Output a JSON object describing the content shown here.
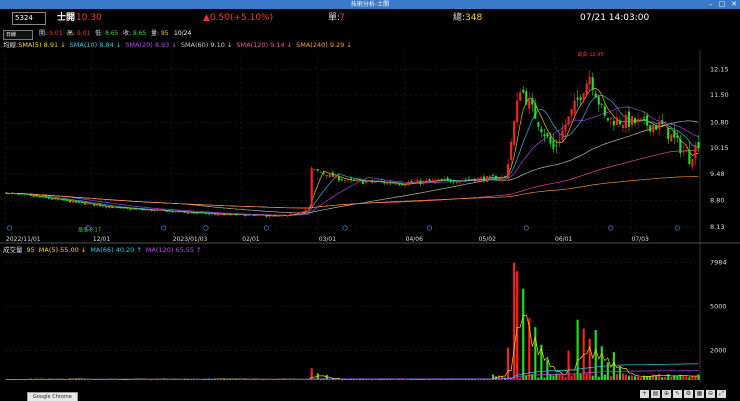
{
  "window": {
    "title": "技術分析-士開",
    "min": "–",
    "max": "□",
    "close": "✕"
  },
  "header": {
    "stock_code": "5324",
    "stock_name": "士開",
    "price": "10.30",
    "change": "▲0.50(+5.10%)",
    "single_label": "單:",
    "single_value": "7",
    "total_label": "總:",
    "total_value": "348",
    "datetime": "07/21 14:03:00"
  },
  "ohlc": {
    "period": "日線",
    "open_label": "開:",
    "open": "9.01",
    "high_label": "高:",
    "high": "9.01",
    "low_label": "低:",
    "low": "8.65",
    "close_label": "收:",
    "close": "8.65",
    "volume_label": "量:",
    "volume": "95",
    "date": "10/24"
  },
  "ma_legend": {
    "prefix": "均線:",
    "items": [
      {
        "text": "SMA(5) 8.91 ↓",
        "color": "#ffd700"
      },
      {
        "text": "SMA(10) 8.84 ↓",
        "color": "#22d3e8"
      },
      {
        "text": "SMA(20) 8.93 ↓",
        "color": "#c040ff"
      },
      {
        "text": "SMA(60) 9.10 ↓",
        "color": "#c8c8c8"
      },
      {
        "text": "SMA(120) 9.14 ↓",
        "color": "#ff4fa0"
      },
      {
        "text": "SMA(240) 9.29 ↓",
        "color": "#ff9a30"
      }
    ]
  },
  "vol_legend": {
    "prefix": "成交量",
    "value": "95",
    "items": [
      {
        "text": "MA(5) 55.00 ↓",
        "color": "#ffd700"
      },
      {
        "text": "MA(66) 40.20 ↑",
        "color": "#22d3e8"
      },
      {
        "text": "MA(120) 65.55 ↑",
        "color": "#c040ff"
      }
    ]
  },
  "annotations": {
    "high_mark": "最高:12.45",
    "low_mark": "最低:8.17"
  },
  "price_axis": [
    "12.15",
    "11.50",
    "10.80",
    "10.15",
    "9.48",
    "8.80",
    "8.13"
  ],
  "volume_axis": [
    "7984",
    "5000",
    "2000"
  ],
  "date_axis": [
    "2022/11/01",
    "12/01",
    "2023/01/03",
    "02/01",
    "03/01",
    "04/06",
    "05/02",
    "06/01",
    "07/03"
  ],
  "taskbar_hint": "Google Chrome",
  "toolbar_icons": [
    "cross-icon",
    "print-icon",
    "zoom-in-icon",
    "cursor-icon",
    "settings-icon",
    "grid-icon",
    "zoom-out-icon",
    "expand-icon"
  ],
  "colors": {
    "up": "#ff2020",
    "down": "#22e022",
    "price_up": "#ff3030",
    "accent_blue": "#3a78c8"
  },
  "chart_data": [
    {
      "type": "candlestick",
      "title": "",
      "x_ticks": [
        "2022/11/01",
        "12/01",
        "2023/01/03",
        "02/01",
        "03/01",
        "04/06",
        "05/02",
        "06/01",
        "07/03"
      ],
      "ylim": [
        8.0,
        12.6
      ],
      "y_ticks": [
        12.15,
        11.5,
        10.8,
        10.15,
        9.48,
        8.8,
        8.13
      ],
      "high": 12.45,
      "low": 8.17,
      "segments": [
        {
          "from": 0,
          "to": 38,
          "start": 9.0,
          "end": 8.6
        },
        {
          "from": 38,
          "to": 70,
          "start": 8.6,
          "end": 8.45
        },
        {
          "from": 70,
          "to": 92,
          "start": 8.45,
          "end": 8.4
        },
        {
          "from": 92,
          "to": 100,
          "start": 8.4,
          "end": 8.6
        },
        {
          "from": 100,
          "to": 101,
          "start": 8.6,
          "end": 9.6
        },
        {
          "from": 101,
          "to": 113,
          "start": 9.6,
          "end": 9.3
        },
        {
          "from": 113,
          "to": 131,
          "start": 9.3,
          "end": 9.25
        },
        {
          "from": 131,
          "to": 165,
          "start": 9.25,
          "end": 9.4
        },
        {
          "from": 165,
          "to": 170,
          "start": 9.4,
          "end": 11.7
        },
        {
          "from": 170,
          "to": 181,
          "start": 11.7,
          "end": 10.1
        },
        {
          "from": 181,
          "to": 193,
          "start": 10.1,
          "end": 12.0
        },
        {
          "from": 193,
          "to": 198,
          "start": 12.0,
          "end": 10.9
        },
        {
          "from": 198,
          "to": 217,
          "start": 10.9,
          "end": 10.7
        },
        {
          "from": 217,
          "to": 226,
          "start": 10.7,
          "end": 9.9
        },
        {
          "from": 226,
          "to": 229,
          "start": 9.9,
          "end": 10.3
        }
      ],
      "count": 230
    },
    {
      "type": "bar",
      "title": "成交量",
      "ylim": [
        0,
        8300
      ],
      "y_ticks": [
        7984,
        5000,
        2000
      ],
      "spikes": [
        {
          "index": 101,
          "value": 800
        },
        {
          "index": 103,
          "value": 450
        },
        {
          "index": 106,
          "value": 350
        },
        {
          "index": 166,
          "value": 2200
        },
        {
          "index": 168,
          "value": 7984
        },
        {
          "index": 169,
          "value": 7400
        },
        {
          "index": 171,
          "value": 6200
        },
        {
          "index": 173,
          "value": 4200
        },
        {
          "index": 175,
          "value": 3600
        },
        {
          "index": 177,
          "value": 2400
        },
        {
          "index": 179,
          "value": 1400
        },
        {
          "index": 186,
          "value": 2000
        },
        {
          "index": 189,
          "value": 4100
        },
        {
          "index": 191,
          "value": 3500
        },
        {
          "index": 193,
          "value": 2800
        },
        {
          "index": 195,
          "value": 3400
        },
        {
          "index": 197,
          "value": 2300
        },
        {
          "index": 199,
          "value": 1200
        },
        {
          "index": 201,
          "value": 1900
        },
        {
          "index": 203,
          "value": 900
        }
      ],
      "count": 230
    }
  ]
}
